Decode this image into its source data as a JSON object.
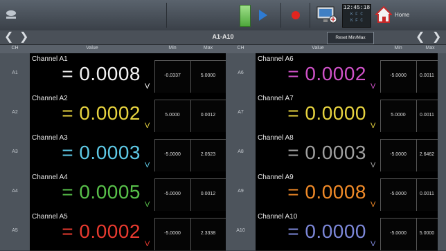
{
  "toolbar": {
    "clock_time": "12:45:18",
    "clock_status_line1": "K F C",
    "clock_status_line2": "K F C",
    "home_label": "Home"
  },
  "nav": {
    "title": "A1-A10",
    "tooltip": "Reset Min/Max"
  },
  "columns": {
    "ch": "CH",
    "value": "Value",
    "min": "Min",
    "max": "Max"
  },
  "colors": {
    "white": "#f2f2f2",
    "yellow": "#e7d33f",
    "cyan": "#5ec9e6",
    "green": "#58c04a",
    "red": "#e83a2f",
    "magenta": "#d052c9",
    "gray": "#a0a0a0",
    "orange": "#f08a28",
    "blue": "#7c87d8"
  },
  "channels_left": [
    {
      "ch": "A1",
      "name": "Channel A1",
      "value": "= 0.0008",
      "unit": "V",
      "min": "-0.0337",
      "max": "5.0000",
      "color": "#f2f2f2"
    },
    {
      "ch": "A2",
      "name": "Channel A2",
      "value": "= 0.0002",
      "unit": "V",
      "min": "5.0000",
      "max": "0.0012",
      "color": "#e7d33f"
    },
    {
      "ch": "A3",
      "name": "Channel A3",
      "value": "= 0.0003",
      "unit": "V",
      "min": "-5.0000",
      "max": "2.0523",
      "color": "#5ec9e6"
    },
    {
      "ch": "A4",
      "name": "Channel A4",
      "value": "= 0.0005",
      "unit": "V",
      "min": "-5.0000",
      "max": "0.0012",
      "color": "#58c04a"
    },
    {
      "ch": "A5",
      "name": "Channel A5",
      "value": "= 0.0002",
      "unit": "V",
      "min": "-5.0000",
      "max": "2.3338",
      "color": "#e83a2f"
    }
  ],
  "channels_right": [
    {
      "ch": "A6",
      "name": "Channel A6",
      "value": "= 0.0002",
      "unit": "V",
      "min": "-5.0000",
      "max": "0.0011",
      "color": "#d052c9"
    },
    {
      "ch": "A7",
      "name": "Channel A7",
      "value": "= 0.0000",
      "unit": "V",
      "min": "5.0000",
      "max": "0.0011",
      "color": "#e7d33f"
    },
    {
      "ch": "A8",
      "name": "Channel A8",
      "value": "= 0.0003",
      "unit": "V",
      "min": "-5.0000",
      "max": "2.6462",
      "color": "#a0a0a0"
    },
    {
      "ch": "A9",
      "name": "Channel A9",
      "value": "= 0.0008",
      "unit": "V",
      "min": "-5.0000",
      "max": "0.0011",
      "color": "#f08a28"
    },
    {
      "ch": "A10",
      "name": "Channel A10",
      "value": "= 0.0000",
      "unit": "V",
      "min": "-5.0000",
      "max": "5.0000",
      "color": "#7c87d8"
    }
  ]
}
